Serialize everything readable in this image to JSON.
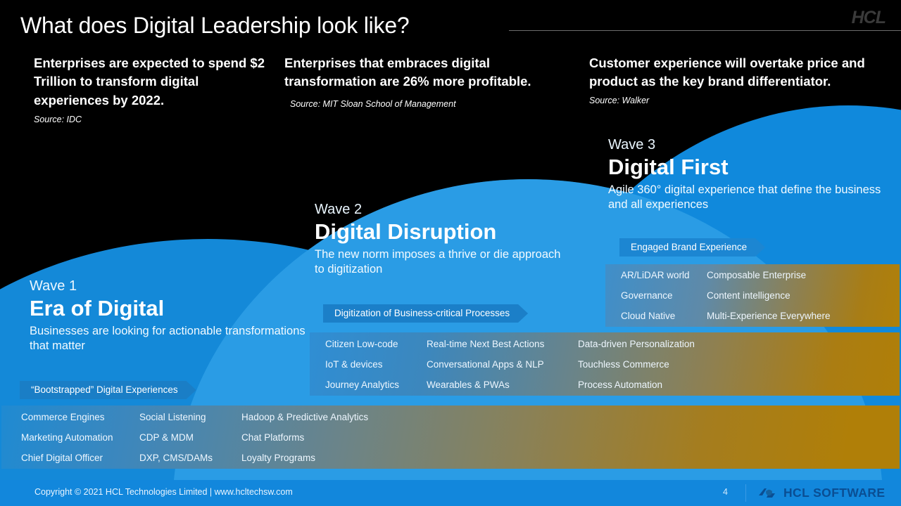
{
  "header": {
    "title": "What does Digital Leadership look like?",
    "logo": "HCL"
  },
  "stats": [
    {
      "headline": "Enterprises are expected to spend $2 Trillion to transform digital experiences by 2022.",
      "source": "Source: IDC"
    },
    {
      "headline": "Enterprises that embraces digital transformation are 26% more profitable.",
      "source": "Source: MIT Sloan School of Management"
    },
    {
      "headline": "Customer experience will overtake price and product as the key brand differentiator.",
      "source": "Source: Walker"
    }
  ],
  "waves": [
    {
      "number": "Wave 1",
      "name": "Era of Digital",
      "description": "Businesses are looking for actionable transformations that matter",
      "tag": "“Bootstrapped” Digital Experiences",
      "columns": [
        [
          "Commerce Engines",
          "Marketing Automation",
          "Chief Digital Officer"
        ],
        [
          "Social Listening",
          "CDP & MDM",
          "DXP, CMS/DAMs"
        ],
        [
          "Hadoop & Predictive Analytics",
          "Chat Platforms",
          "Loyalty Programs"
        ]
      ]
    },
    {
      "number": "Wave 2",
      "name": "Digital Disruption",
      "description": "The new norm imposes a thrive or die approach to digitization",
      "tag": "Digitization of Business-critical Processes",
      "columns": [
        [
          "Citizen Low-code",
          "IoT & devices",
          "Journey Analytics"
        ],
        [
          "Real-time Next Best Actions",
          "Conversational Apps & NLP",
          "Wearables & PWAs"
        ],
        [
          "Data-driven Personalization",
          "Touchless Commerce",
          "Process Automation"
        ]
      ]
    },
    {
      "number": "Wave 3",
      "name": "Digital First",
      "description": "Agile 360° digital experience that define the business and all experiences",
      "tag": "Engaged Brand Experience",
      "columns": [
        [
          "AR/LiDAR world",
          "Governance",
          "Cloud Native"
        ],
        [
          "Composable Enterprise",
          "Content intelligence",
          "Multi-Experience Everywhere"
        ]
      ]
    }
  ],
  "footer": {
    "copyright": "Copyright © 2021 HCL Technologies Limited  |  www.hcltechsw.com",
    "page_number": "4",
    "brand": "HCL SOFTWARE"
  },
  "colors": {
    "background": "#000000",
    "wave1": "#1489d8",
    "wave2": "#1d93e0",
    "wave3": "#1089dc",
    "tag": "#1b7dc4",
    "band_gold": "#b07f08",
    "footer": "#1287dc",
    "brand_navy": "#0a4e93"
  }
}
